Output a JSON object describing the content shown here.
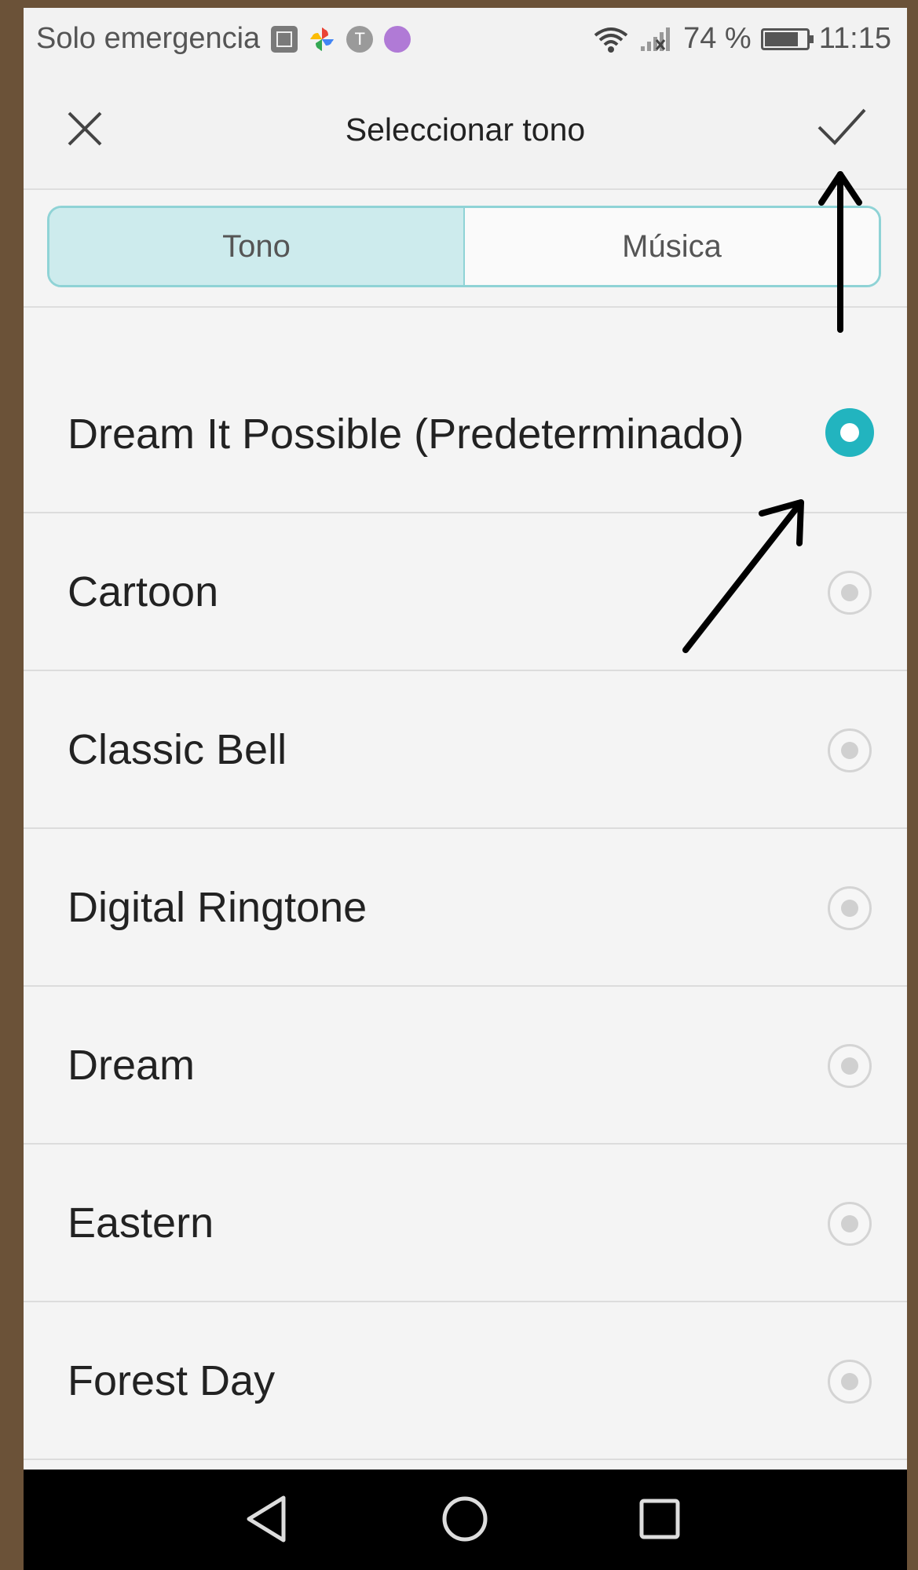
{
  "status_bar": {
    "carrier_text": "Solo emergencia",
    "battery_percent": "74 %",
    "time": "11:15",
    "icons": [
      "gallery-icon",
      "pinwheel-icon",
      "t-icon",
      "message-icon",
      "wifi-icon",
      "signal-icon",
      "battery-icon"
    ]
  },
  "header": {
    "title": "Seleccionar tono",
    "close_icon": "close-icon",
    "confirm_icon": "checkmark-icon"
  },
  "tabs": [
    {
      "label": "Tono",
      "active": true
    },
    {
      "label": "Música",
      "active": false
    }
  ],
  "ringtones": [
    {
      "label": "Dream It Possible (Predeterminado)",
      "selected": true
    },
    {
      "label": "Cartoon",
      "selected": false
    },
    {
      "label": "Classic Bell",
      "selected": false
    },
    {
      "label": "Digital Ringtone",
      "selected": false
    },
    {
      "label": "Dream",
      "selected": false
    },
    {
      "label": "Eastern",
      "selected": false
    },
    {
      "label": "Forest Day",
      "selected": false
    }
  ],
  "nav_bar": {
    "icons": [
      "back-icon",
      "home-icon",
      "recents-icon"
    ]
  },
  "colors": {
    "accent": "#22b4bf",
    "tab_active_bg": "#cdebed",
    "tab_border": "#8fd3d6",
    "frame": "#6b5238"
  }
}
